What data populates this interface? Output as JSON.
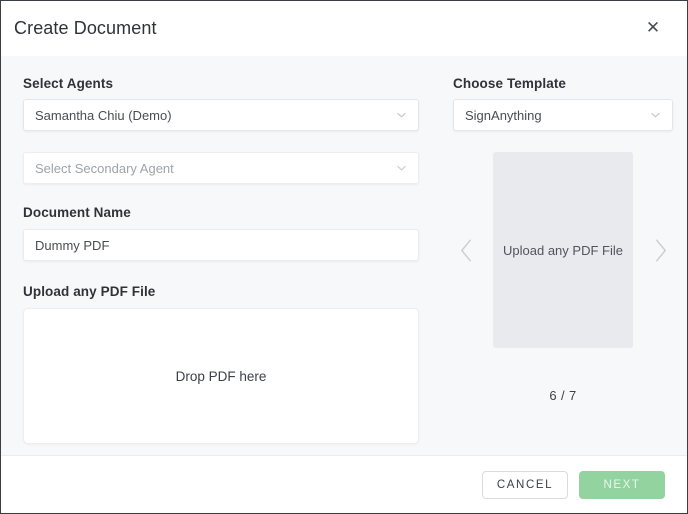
{
  "dialog": {
    "title": "Create Document",
    "close_icon": "close-icon"
  },
  "left": {
    "agents_label": "Select Agents",
    "primary_agent": {
      "value": "Samantha Chiu (Demo)",
      "icon": "chevron-down-icon"
    },
    "secondary_agent": {
      "placeholder": "Select Secondary Agent",
      "icon": "chevron-down-icon"
    },
    "document_name_label": "Document Name",
    "document_name_value": "Dummy PDF",
    "upload_label": "Upload any PDF File",
    "dropzone_text": "Drop PDF here"
  },
  "right": {
    "template_label": "Choose Template",
    "template_value": "SignAnything",
    "template_icon": "chevron-down-icon",
    "preview_text": "Upload any PDF File",
    "prev_icon": "chevron-left-icon",
    "next_icon": "chevron-right-icon",
    "counter": "6 / 7"
  },
  "footer": {
    "cancel_label": "CANCEL",
    "next_label": "NEXT"
  },
  "colors": {
    "accent_green": "#93d3a0",
    "panel_background": "#f7f8f9",
    "preview_card": "#e8eaed",
    "text_primary": "#2f3237",
    "text_muted": "#9ea3a9"
  }
}
